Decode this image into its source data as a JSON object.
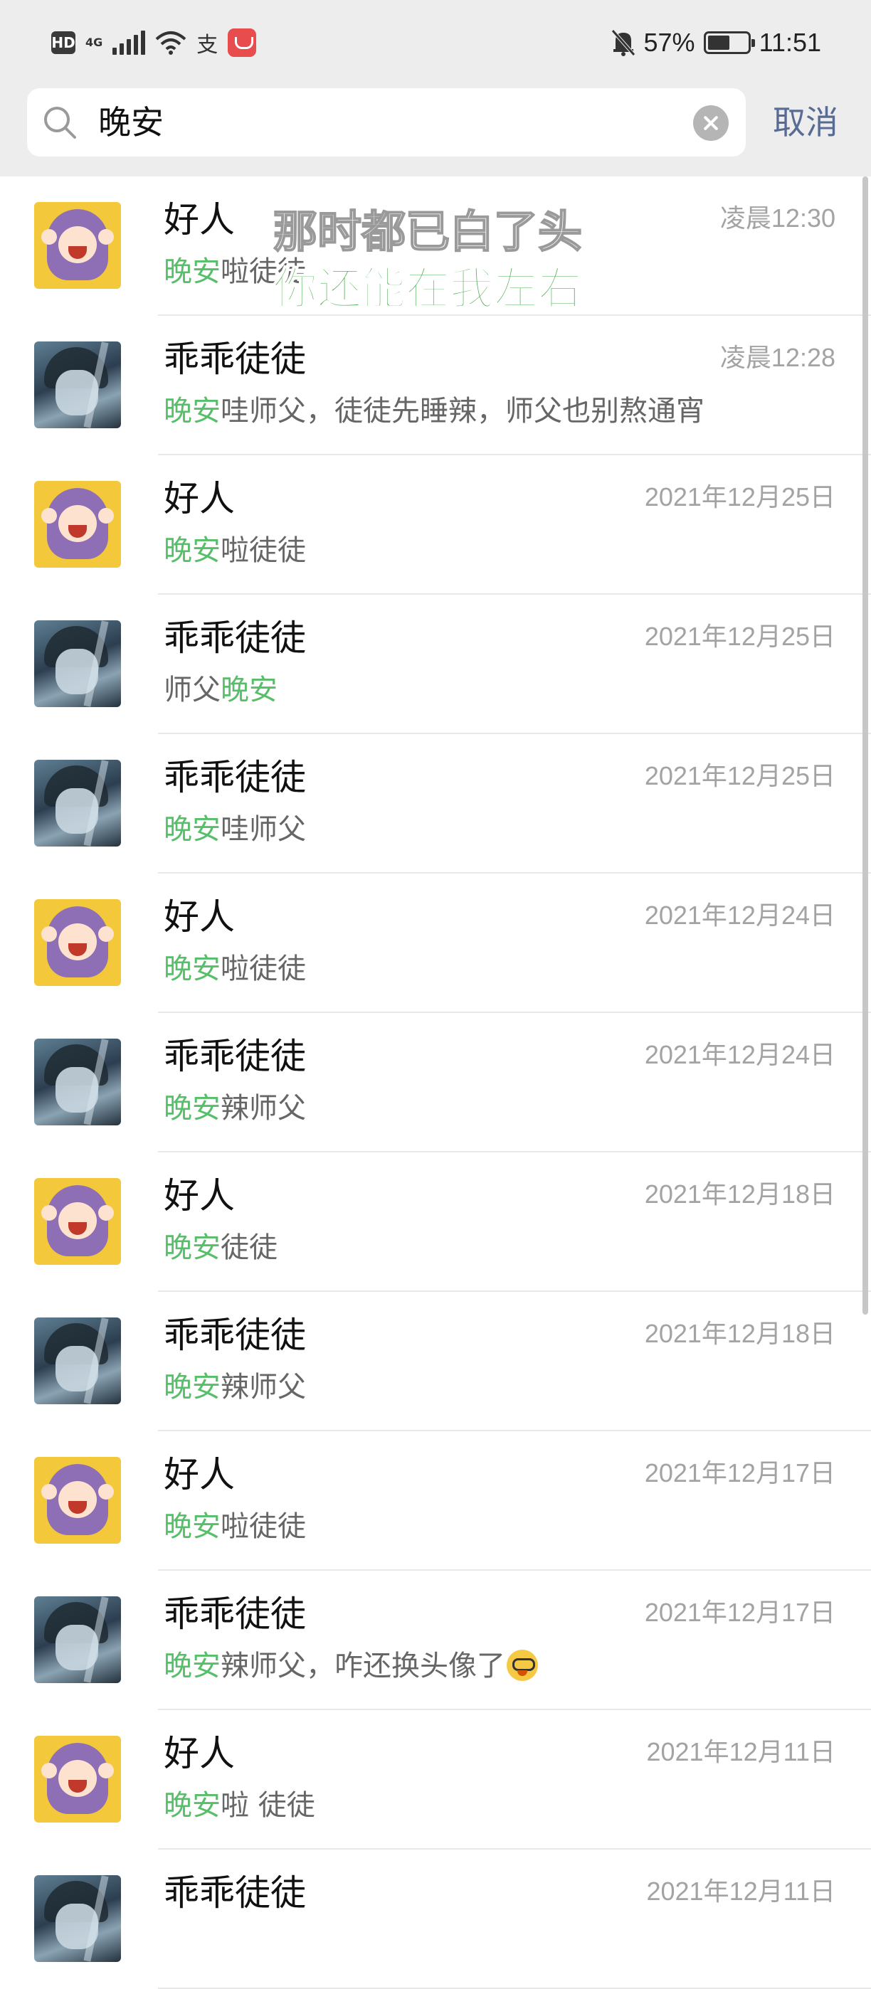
{
  "status_bar": {
    "hd": "HD",
    "network": "4G",
    "battery_percent": "57%",
    "battery_level": 0.57,
    "time": "11:51",
    "icons": [
      "signal-icon",
      "wifi-icon",
      "alipay-icon",
      "huawei-app-icon",
      "mute-bell-icon",
      "battery-icon"
    ]
  },
  "search": {
    "query": "晚安",
    "cancel_label": "取消"
  },
  "lyrics": {
    "line1": "那时都已白了头",
    "line2": "你还能在我左右"
  },
  "results": [
    {
      "name": "好人",
      "time": "凌晨12:30",
      "avatar": "girl",
      "msg_pre": "",
      "msg_hl": "晚安",
      "msg_post": "啦徒徒"
    },
    {
      "name": "乖乖徒徒",
      "time": "凌晨12:28",
      "avatar": "boy",
      "msg_pre": "",
      "msg_hl": "晚安",
      "msg_post": "哇师父，徒徒先睡辣，师父也别熬通宵"
    },
    {
      "name": "好人",
      "time": "2021年12月25日",
      "avatar": "girl",
      "msg_pre": "",
      "msg_hl": "晚安",
      "msg_post": "啦徒徒"
    },
    {
      "name": "乖乖徒徒",
      "time": "2021年12月25日",
      "avatar": "boy",
      "msg_pre": "师父",
      "msg_hl": "晚安",
      "msg_post": ""
    },
    {
      "name": "乖乖徒徒",
      "time": "2021年12月25日",
      "avatar": "boy",
      "msg_pre": "",
      "msg_hl": "晚安",
      "msg_post": "哇师父"
    },
    {
      "name": "好人",
      "time": "2021年12月24日",
      "avatar": "girl",
      "msg_pre": "",
      "msg_hl": "晚安",
      "msg_post": "啦徒徒"
    },
    {
      "name": "乖乖徒徒",
      "time": "2021年12月24日",
      "avatar": "boy",
      "msg_pre": "",
      "msg_hl": "晚安",
      "msg_post": "辣师父"
    },
    {
      "name": "好人",
      "time": "2021年12月18日",
      "avatar": "girl",
      "msg_pre": "",
      "msg_hl": "晚安",
      "msg_post": "徒徒"
    },
    {
      "name": "乖乖徒徒",
      "time": "2021年12月18日",
      "avatar": "boy",
      "msg_pre": "",
      "msg_hl": "晚安",
      "msg_post": "辣师父"
    },
    {
      "name": "好人",
      "time": "2021年12月17日",
      "avatar": "girl",
      "msg_pre": "",
      "msg_hl": "晚安",
      "msg_post": "啦徒徒"
    },
    {
      "name": "乖乖徒徒",
      "time": "2021年12月17日",
      "avatar": "boy",
      "msg_pre": "",
      "msg_hl": "晚安",
      "msg_post": "辣师父，咋还换头像了",
      "emoji": "goofy-face-emoji"
    },
    {
      "name": "好人",
      "time": "2021年12月11日",
      "avatar": "girl",
      "msg_pre": "",
      "msg_hl": "晚安",
      "msg_post": "啦 徒徒"
    },
    {
      "name": "乖乖徒徒",
      "time": "2021年12月11日",
      "avatar": "boy",
      "msg_pre": "",
      "msg_hl": "",
      "msg_post": ""
    }
  ]
}
